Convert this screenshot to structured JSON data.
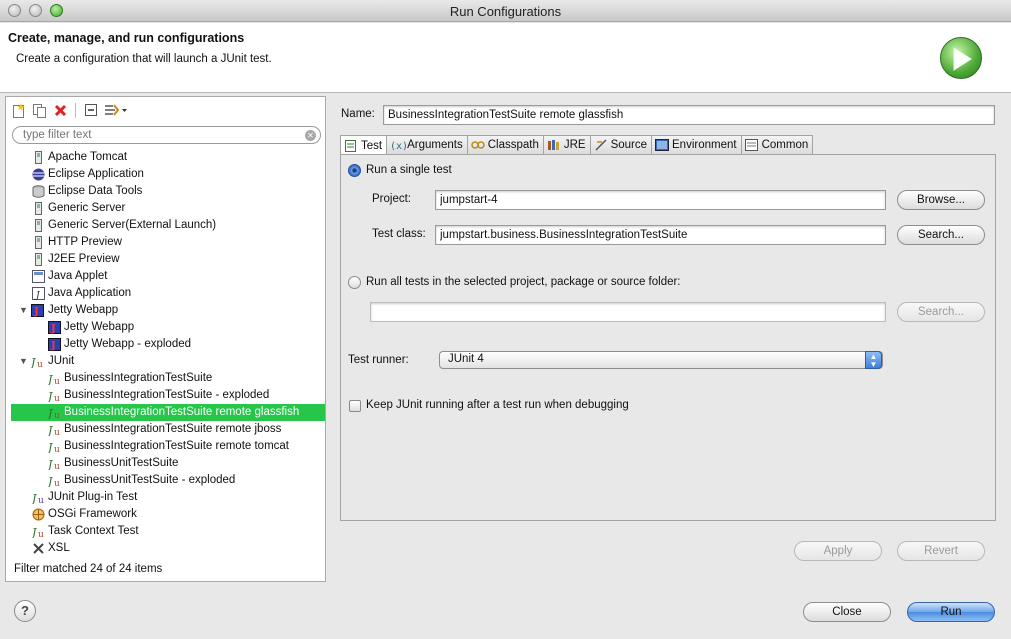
{
  "window": {
    "title": "Run Configurations"
  },
  "header": {
    "title": "Create, manage, and run configurations",
    "description": "Create a configuration that will launch a JUnit test."
  },
  "sidebar": {
    "filter_placeholder": "type filter text",
    "status": "Filter matched 24 of 24 items",
    "items": [
      {
        "label": "Apache Tomcat",
        "icon": "server-icon",
        "level": 1
      },
      {
        "label": "Eclipse Application",
        "icon": "eclipse-icon",
        "level": 1
      },
      {
        "label": "Eclipse Data Tools",
        "icon": "database-icon",
        "level": 1
      },
      {
        "label": "Generic Server",
        "icon": "server-icon",
        "level": 1
      },
      {
        "label": "Generic Server(External Launch)",
        "icon": "server-icon",
        "level": 1
      },
      {
        "label": "HTTP Preview",
        "icon": "server-icon",
        "level": 1
      },
      {
        "label": "J2EE Preview",
        "icon": "server-icon",
        "level": 1
      },
      {
        "label": "Java Applet",
        "icon": "applet-icon",
        "level": 1
      },
      {
        "label": "Java Application",
        "icon": "java-icon",
        "level": 1
      },
      {
        "label": "Jetty Webapp",
        "icon": "jetty-icon",
        "level": 0,
        "expanded": true
      },
      {
        "label": "Jetty Webapp",
        "icon": "jetty-icon",
        "level": 2
      },
      {
        "label": "Jetty Webapp - exploded",
        "icon": "jetty-icon",
        "level": 2
      },
      {
        "label": "JUnit",
        "icon": "junit-icon",
        "level": 0,
        "expanded": true
      },
      {
        "label": "BusinessIntegrationTestSuite",
        "icon": "junit-icon",
        "level": 2
      },
      {
        "label": "BusinessIntegrationTestSuite - exploded",
        "icon": "junit-icon",
        "level": 2
      },
      {
        "label": "BusinessIntegrationTestSuite remote glassfish",
        "icon": "junit-icon",
        "level": 2,
        "selected": true
      },
      {
        "label": "BusinessIntegrationTestSuite remote jboss",
        "icon": "junit-icon",
        "level": 2
      },
      {
        "label": "BusinessIntegrationTestSuite remote tomcat",
        "icon": "junit-icon",
        "level": 2
      },
      {
        "label": "BusinessUnitTestSuite",
        "icon": "junit-icon",
        "level": 2
      },
      {
        "label": "BusinessUnitTestSuite - exploded",
        "icon": "junit-icon",
        "level": 2
      },
      {
        "label": "JUnit Plug-in Test",
        "icon": "junit-plugin-icon",
        "level": 1
      },
      {
        "label": "OSGi Framework",
        "icon": "osgi-icon",
        "level": 1
      },
      {
        "label": "Task Context Test",
        "icon": "junit-icon",
        "level": 1
      },
      {
        "label": "XSL",
        "icon": "xsl-icon",
        "level": 1
      }
    ]
  },
  "config": {
    "name_label": "Name:",
    "name_value": "BusinessIntegrationTestSuite remote glassfish",
    "tabs": [
      "Test",
      "Arguments",
      "Classpath",
      "JRE",
      "Source",
      "Environment",
      "Common"
    ],
    "active_tab": "Test",
    "single_test_label": "Run a single test",
    "project_label": "Project:",
    "project_value": "jumpstart-4",
    "browse_label": "Browse...",
    "test_class_label": "Test class:",
    "test_class_value": "jumpstart.business.BusinessIntegrationTestSuite",
    "search_label": "Search...",
    "all_tests_label": "Run all tests in the selected project, package or source folder:",
    "all_tests_value": "",
    "search2_label": "Search...",
    "runner_label": "Test runner:",
    "runner_value": "JUnit 4",
    "keep_running_label": "Keep JUnit running after a test run when debugging",
    "apply_label": "Apply",
    "revert_label": "Revert"
  },
  "footer": {
    "close_label": "Close",
    "run_label": "Run",
    "help_glyph": "?"
  },
  "colors": {
    "selection": "#27c64b",
    "primary_button": "#4a8ce0",
    "run_icon": "#4aa733"
  }
}
